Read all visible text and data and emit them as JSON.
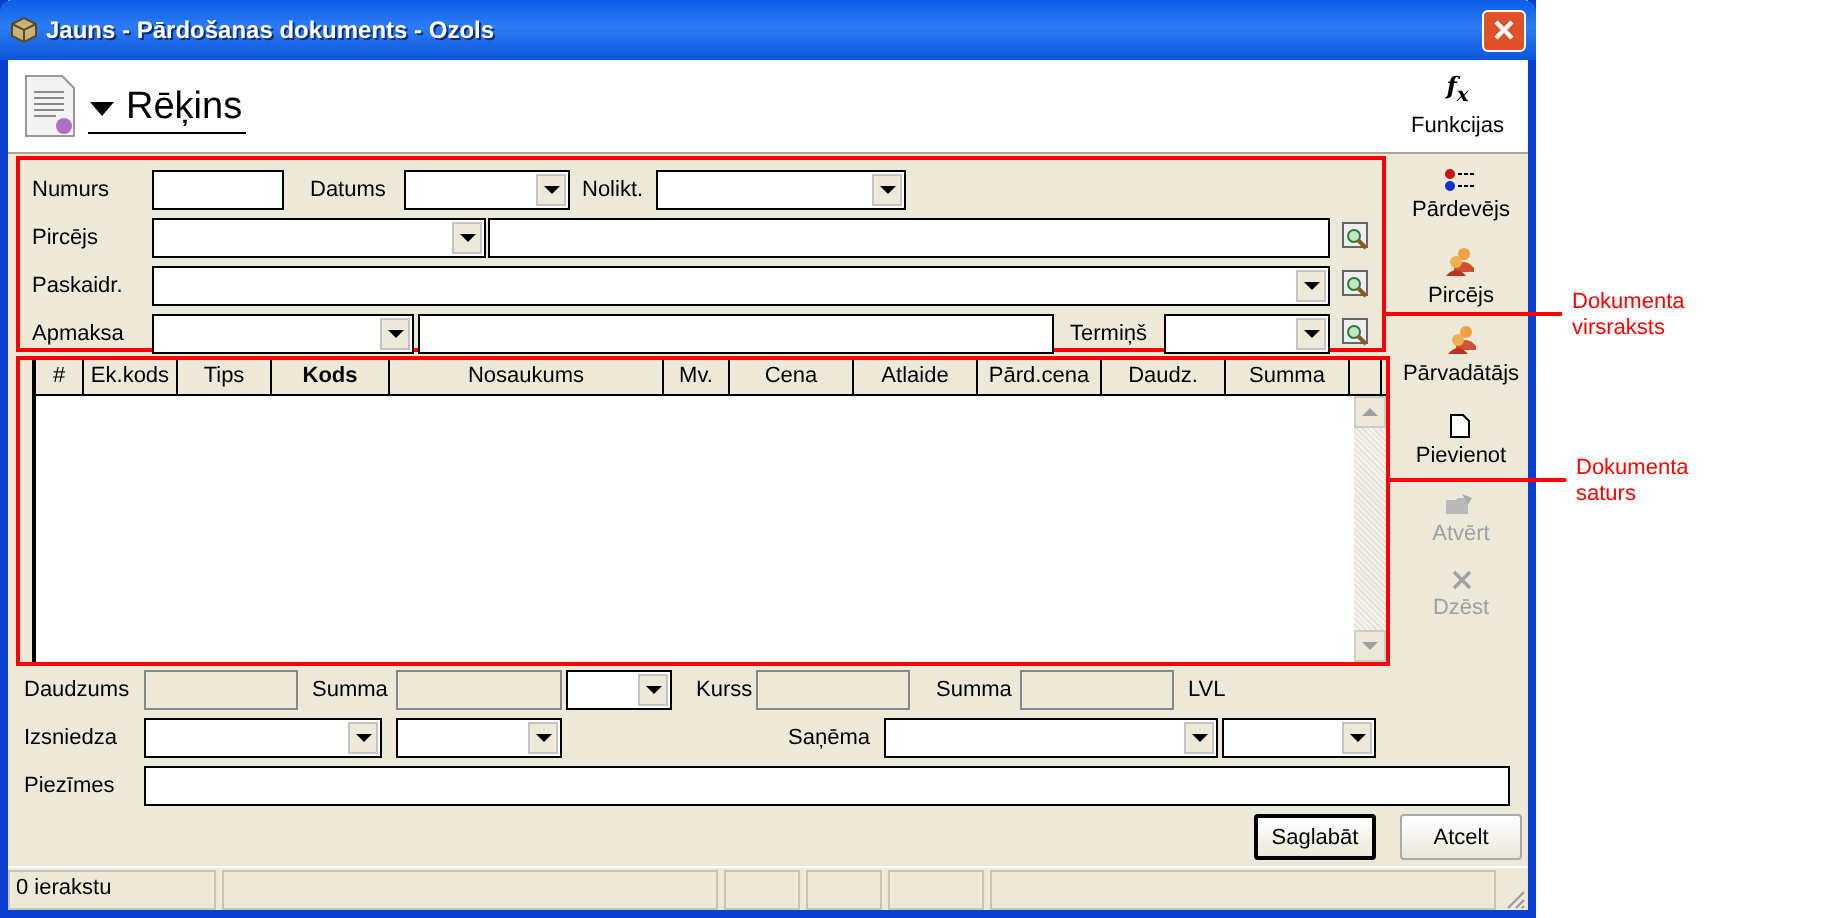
{
  "window": {
    "title": "Jauns - Pārdošanas dokuments - Ozols"
  },
  "document": {
    "type": "Rēķins"
  },
  "functions_button": {
    "symbol": "f$_{x}$",
    "label": "Funkcijas"
  },
  "header_form": {
    "labels": [
      "Numurs",
      "Datums",
      "Nolikt.",
      "Pircējs",
      "Paskaidr.",
      "Apmaksa",
      "Termiņš"
    ]
  },
  "sidebar": {
    "items": [
      {
        "label": "Pārdevējs",
        "kind": "sellers",
        "disabled": false
      },
      {
        "label": "Pircējs",
        "kind": "person",
        "disabled": false
      },
      {
        "label": "Pārvadātājs",
        "kind": "person",
        "disabled": false
      },
      {
        "label": "Pievienot",
        "kind": "new",
        "disabled": false
      },
      {
        "label": "Atvērt",
        "kind": "open",
        "disabled": true
      },
      {
        "label": "Dzēst",
        "kind": "delete",
        "disabled": true
      }
    ]
  },
  "table": {
    "columns": [
      {
        "label": "#",
        "bold": false
      },
      {
        "label": "Ek.kods",
        "bold": false
      },
      {
        "label": "Tips",
        "bold": false
      },
      {
        "label": "Kods",
        "bold": true
      },
      {
        "label": "Nosaukums",
        "bold": false
      },
      {
        "label": "Mv.",
        "bold": false
      },
      {
        "label": "Cena",
        "bold": false
      },
      {
        "label": "Atlaide",
        "bold": false
      },
      {
        "label": "Pārd.cena",
        "bold": false
      },
      {
        "label": "Daudz.",
        "bold": false
      },
      {
        "label": "Summa",
        "bold": false
      }
    ]
  },
  "totals": {
    "labels": [
      "Daudzums",
      "Summa",
      "Kurss",
      "Summa"
    ],
    "currency": "LVL"
  },
  "signatures": {
    "labels": [
      "Izsniedza",
      "Saņēma"
    ]
  },
  "notes": {
    "label": "Piezīmes"
  },
  "buttons": [
    {
      "label": "Saglabāt",
      "default": true
    },
    {
      "label": "Atcelt",
      "default": false
    }
  ],
  "status_bar": {
    "text": "0 ierakstu"
  },
  "annotations": [
    "Dokumenta virsraksts",
    "Dokumenta saturs"
  ]
}
